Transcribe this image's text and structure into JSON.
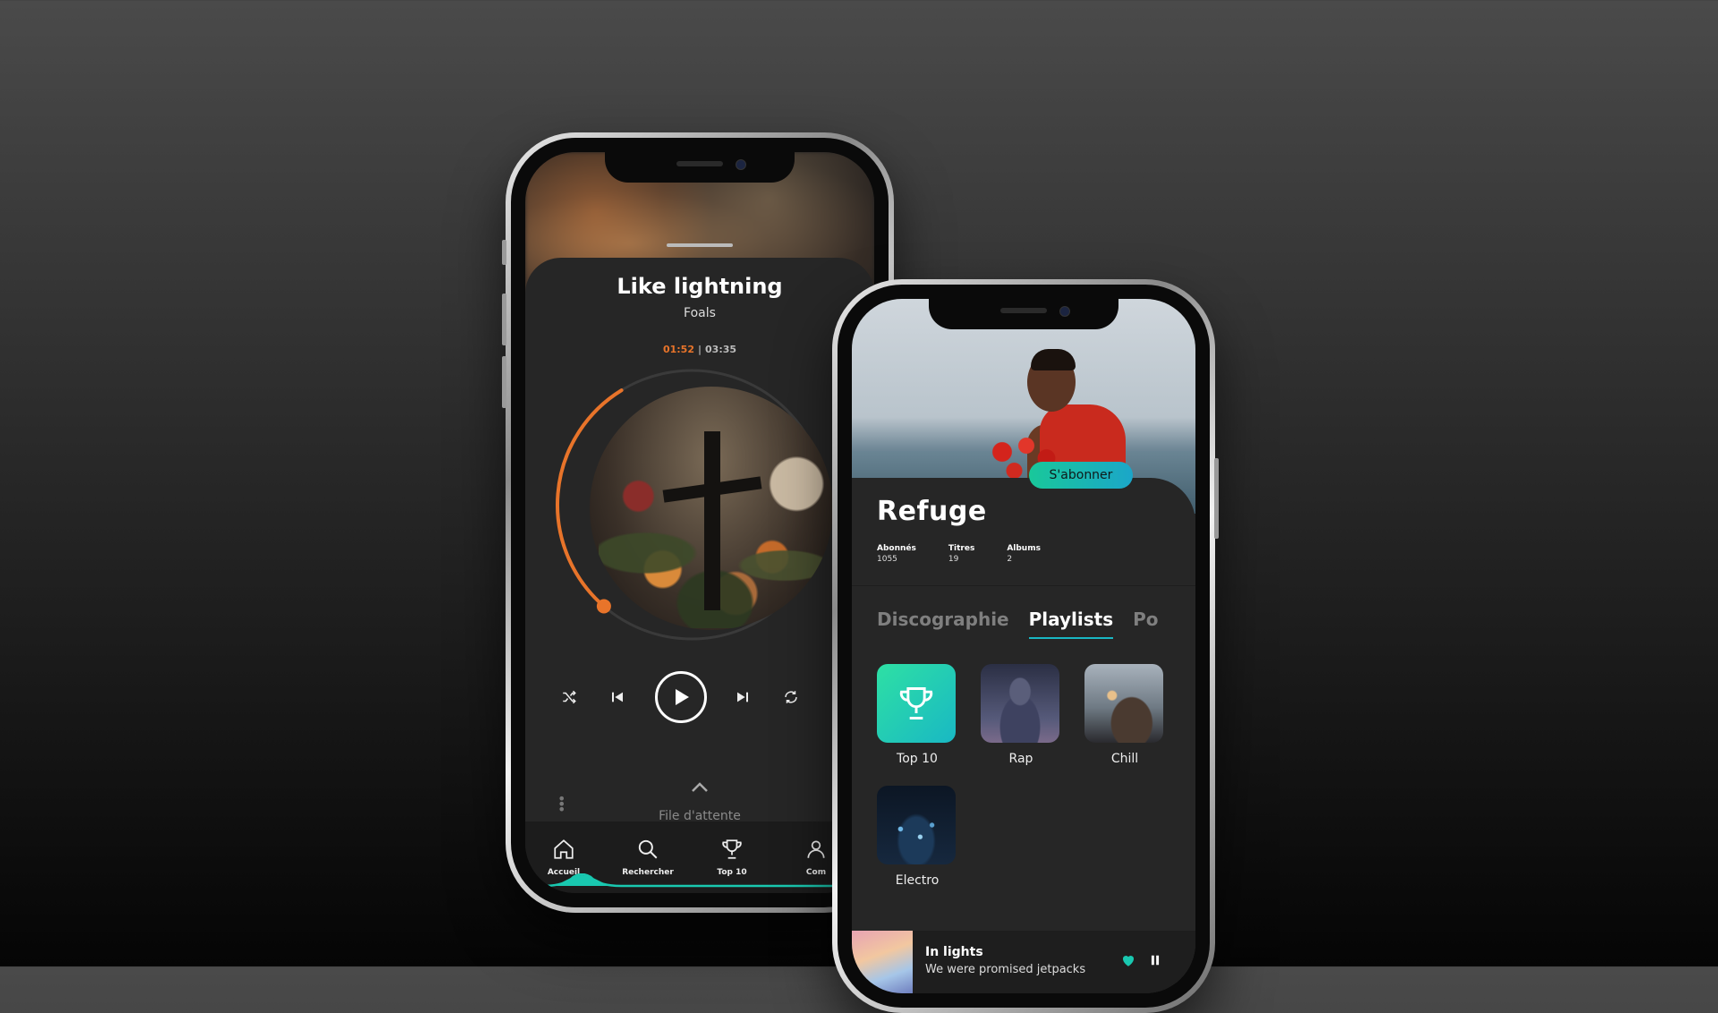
{
  "player": {
    "title": "Like lightning",
    "artist": "Foals",
    "time_current": "01:52",
    "time_separator": "|",
    "time_total": "03:35",
    "progress_fraction": 0.52,
    "queue_label": "File d'attente",
    "tabs": [
      {
        "label": "Accueil",
        "icon": "home-icon"
      },
      {
        "label": "Rechercher",
        "icon": "search-icon"
      },
      {
        "label": "Top 10",
        "icon": "trophy-icon"
      },
      {
        "label": "Com",
        "icon": "user-icon"
      }
    ],
    "accent_color": "#e8742a"
  },
  "artist": {
    "subscribe_label": "S'abonner",
    "name": "Refuge",
    "stats": [
      {
        "key": "Abonnés",
        "value": "1055"
      },
      {
        "key": "Titres",
        "value": "19"
      },
      {
        "key": "Albums",
        "value": "2"
      }
    ],
    "tabs": [
      "Discographie",
      "Playlists",
      "Po"
    ],
    "active_tab": "Playlists",
    "playlists": [
      {
        "label": "Top 10",
        "icon": "trophy-icon"
      },
      {
        "label": "Rap"
      },
      {
        "label": "Chill"
      },
      {
        "label": "Electro"
      }
    ],
    "now_playing": {
      "title": "In lights",
      "subtitle": "We were promised jetpacks"
    },
    "accent_color": "#19c89a"
  }
}
